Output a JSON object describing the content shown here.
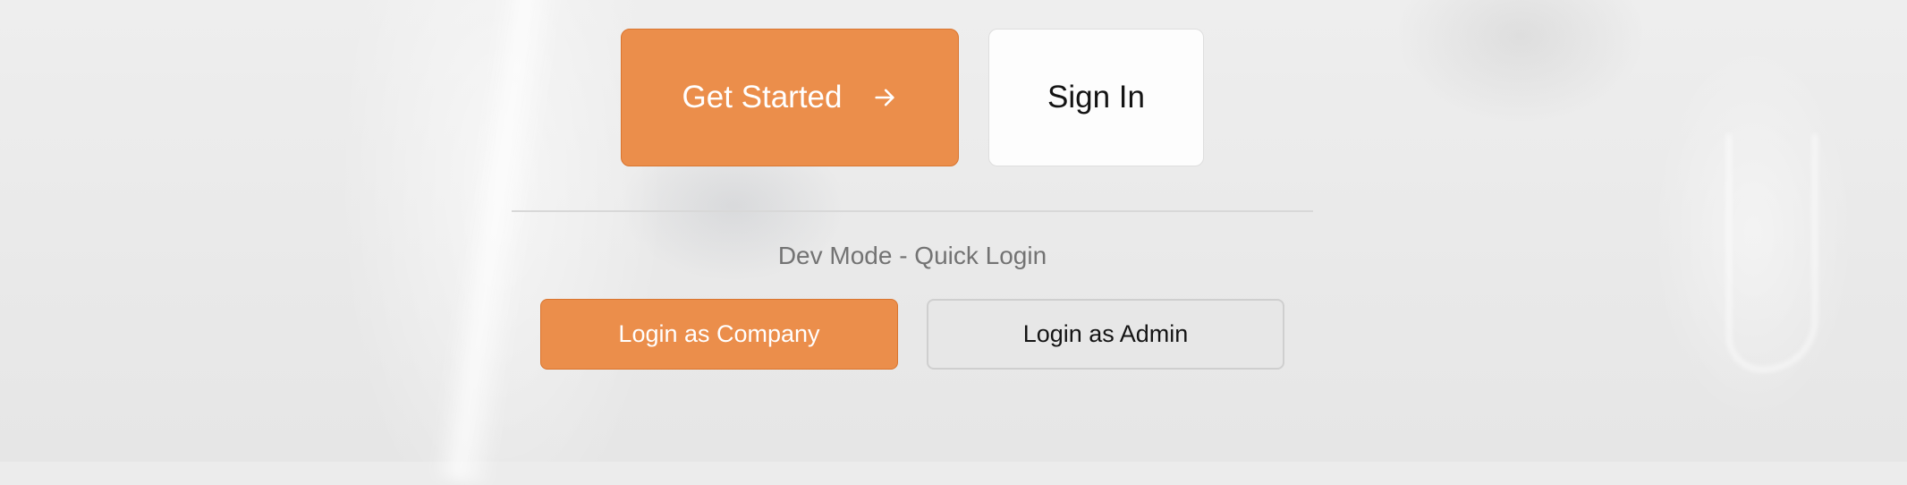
{
  "auth": {
    "get_started_label": "Get Started",
    "get_started_icon": "arrow-right-icon",
    "sign_in_label": "Sign In"
  },
  "dev_mode": {
    "heading": "Dev Mode - Quick Login",
    "login_company_label": "Login as Company",
    "login_admin_label": "Login as Admin"
  },
  "colors": {
    "accent": "#eb8e4b",
    "accent_border": "#d9752f",
    "text_dark": "#141414",
    "text_muted": "#737373"
  }
}
